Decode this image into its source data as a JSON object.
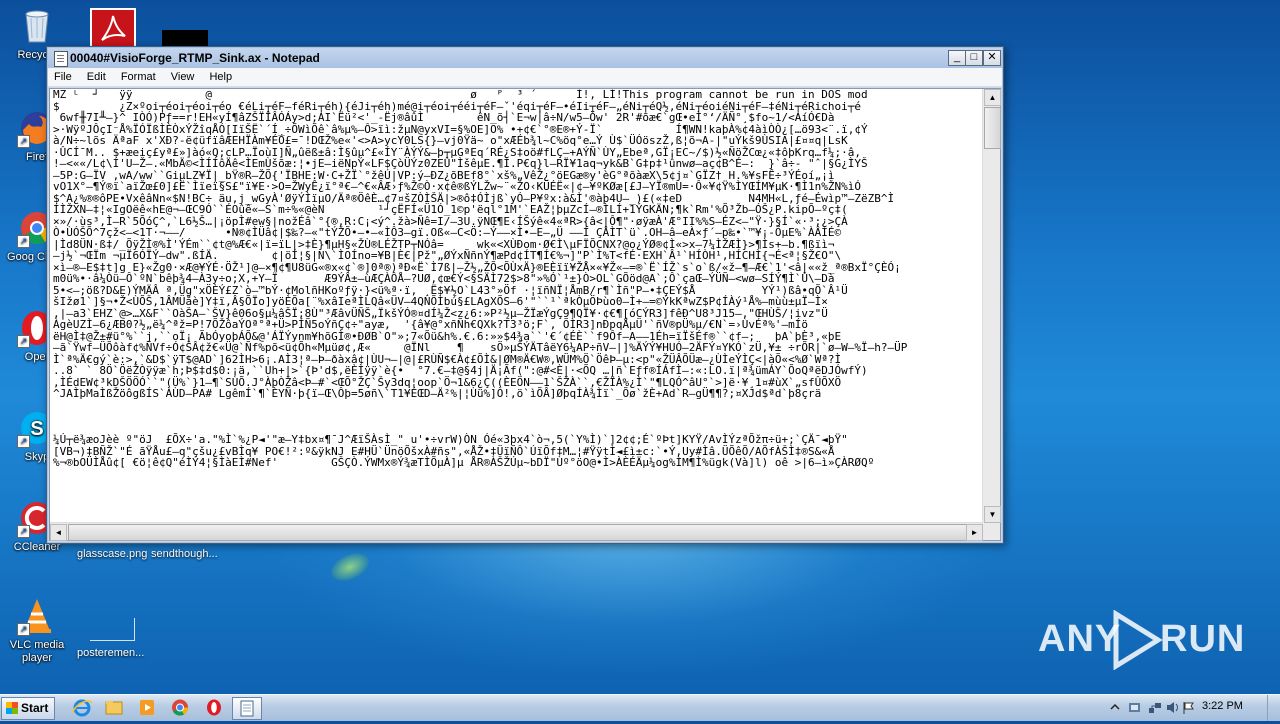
{
  "window": {
    "title": "00040#VisioForge_RTMP_Sink.ax - Notepad",
    "controls": {
      "minimize": "_",
      "maximize": "□",
      "close": "✕"
    }
  },
  "menu": [
    "File",
    "Edit",
    "Format",
    "View",
    "Help"
  ],
  "editor": {
    "lines": [
      "MZ ᴸ  ┘   ÿÿ           @                                       ø   ᴾ  ³ ´      Í!, LÍ!This program cannot be run in DOS mod",
      "$         ¿Z×ºoi┬éoi┬éoi┬éo €éLi┬éF–féRi┬éh){éJi┬éh)mé@i┬éoi┬ééi┬éF–ˇ'éqi┬éF–•éIi┬éF–„éNi┬éQ½,éNi┬éoiéNi┬éF–‡éNi┬éRichoi┬é",
      " 6wf╫7I╨–}^ IÒÓ)Pƒ==r!EH«yÍ¶âZŠÏÎÂÓÁy>d;AI`Ëü²<'_-Ëj®âûÌ        êN_õ┤`E¬w│â÷N/w5–Öw' 2R'#õæ€`gŒ•eÌ°‘/ÄÑ°¸$fo~1/<AíÓ€Dà",
      ">·WÿºJÔçI⁻Å%ÏÓÏßÌÈÒxÝŽîqÅÓ[IïŠË`´Í_÷ÕWìÕê`â%µ%–Ô>ïì:žµN@yxVI=§%OE]O% •+¢€`°®E®+Ý-Ï`           Í¶WN!kaþÀ%¢4àìÒÒ¿[…ö93<¨.ï,¢Ý",
      "à/N÷~lõs ÄªaF x'XÐ?-ë¢üfïâÆEHÏÀm¥ÉÓ£=¯!DŒŽ%e«'<>A>ycY0LS{}–vj0Ÿä~ o\"xÆÉb¾l~C%öq°e…Ý Ù$`ÜÓöszŽ,ß¦õ¬A-|\"uÝkš9ÙSIA|£¤¤q|LsK",
      "·ÛCÍ¯M.. $+æeiç£yª£»]àó«Q;cLP…ÏoùI]Ñ„ûëß±â:Ì§ûµ^£«ÍY¨ÀÝÝ&–þ┬µGªEq´RÉ¿S‡oö#fLÇ–+AÝÑ`ÙY„Ebeª,GÏ¡EC~/$)½«ÑöŽCœ¿«‡ôþKrq…f¼;·â,",
      "!–<««/L¢\\Í'U–Ž–.«MbÄ©<ÌÍÍôÄê<ÌEmÙšõæ:¦•jE–iëNpÝ«LF$ÇòÜÝz0ZEÛ\"ÌšêµE.¶Ì.P€q}l–RÏ¥1aq¬yk&B`G‡p‡¹ûnwø–aç¢B^É–:  }`â÷- \"ˆ|§G¿ÌYŠ",
      "–5P:G–ÏV ,wA/ww``GiµLZ¥Ï|_bŸ®R–ŽÕ{'ÏBHE:W·C+ŽÏ`°žêÚ|VP:ý–ÐZ¿õBEf8°`xš%„VêŽ¿°öEGæ®y'èG°ªõàæX\\5¢j¤`GÏZ† H.%¥sFÊ÷³ÝÉoí„¡ì",
      "vO1X°–¶Ý®ï`aïŽœ£0]£Ë`Ìïeï§S£\"ï¥E·>O=ŽWyÊ¿ï°ª€–^€«ÂÆ›ƒ%Ž©Ò·x¢ê®ßÝLŽw~¨«ŽO‹KÜÉË«|¢–¥ºKØæ[£J–YÏ®mU=·Ô«¥¢Ÿ%ÌYŒÍM¥µK·¶Ì1n%ŽN%ìÓ",
      "$^A¿%®®ôPE•VxêâNn«$N!BC÷ äu‚j_wGyÀ'ØÿÝÌïµO/Äª®ÖêÈ…¢7¤šZÒÌŠÄ|>®ô‡ÓÌjß`yÓ–P¥ºx:à&Ì'®àþ4U–_)£(«‡eD          N4MH«L‚ƒé–Éwìp™–ZëZB^Ì",
      "ÍÌŽXN–‡¦«IgOëê«hE@¬–ŒC9Ó``ÉOûê«–S`m÷%«@èN        ¹┘çËFÍ«Ü1Ó_1©p'ëql°1M'`EAŽ¦þµZcÍ–®ÌLÍ+1ÝGKÄN;¶k`Rm'%Õ³Žb–ÓŠ¿P.kipÕ–ºç‡(",
      "×»/·ùs³,Ì–R`5ÕóÇ^,`L6½Š…|¡öpÌ#ew§|nožÉâ`°{®,R:C¡<ý^.žà>Ñê=I/–3U.ÿNŒ¶E‹ÍŠýê«4«ªR>{â<|Ô¶\"·øÿæÀ'Æ°II%%S–ÉZ<–\"Ÿ·}§Í`«·³;¿>ÇÀ",
      "Ò•ÙÓŠÕ^7çž<–<1T·¬——/      •N®¢ÌÜâ¢|$‰?–«\"tÝŽÕ•–•–«ÌÔ3–gï.Oß«–C<Ö:–Ý——×Ì•–E–„Ü ––Í ÇÂÌT`ü`.OH–â–eÀ×ƒ´–p‰•`™¥¡-ÕµE%`ÀÂÌÉ©",
      "|Ìd8ÜN·ß‡/_ÕÿŽÌ®%Ì'ÝÉm``¢t@%Æ€«|ï=ïL|>‡È}¶µH§«ŽÙ®LÉŽTP┬NÓâ=     wk«<XÙÐom·Ø€Ì\\µFÏÕCNX?@o¿ÝØ®¢Ì«>x–7¼ÌŽÆÌ}>¶Ìs+–b.¶ßïì¬",
      "–j½`¬ŒÏm ¬µÏ6ÓÏÝ–dw\".ßÍÄ.        ¢|öÍ¦§|N\\`ÌOÍno=¥B|È€|Pž\"„ØÝxÑñnÝ¶æPd¢ÍT¶Í€%¬]\"P`Ì%T<fÉ·EXH`Â¹`HÍÒH¹,HÍCHÌ{¬É<ª¦§Ž€O\"\\",
      "×ì–®–E$‡t]g E}«Žg0·×Æ@¥ÝÉ·ÖŽ¹]@–×¶¢¶U8üG«®x«¢`®]0ª®)ªÐ«Ë`Ì7ß|–Ž½„ŽÕ<ÕÙxÄ}®EÈïï¥ŽÅ×«¥Ž«—=®`Ë`ÍŽ`s`o`ß/«ž–¶–Æ€`1'<â|««ž_ª®BxÏ°ÇÈÓ¡",
      "m0ü%•·â¼Òü–Ô`ºN`bêþ¾4–À3y÷o;X,+Y–Ï       Æ9ÝÂ±–ùÆÇÀÔÅ–?UØ,¢œ€Ý<§SÄÌ72$>8\"»%Ó`¹±}Ò>OL`GÕöd@A`;Ô`çaŒ–ÝÜÑ–<wø–SÍÝ¶Ì`Û\\–Dà",
      "5•<–;öß?D&E)ÝMÄÂ ª‚Üg\"xÖÈÝ£Z`ò–™bÝ·¢MolñHKoºƒÿ·}<ü%ª·ï‚ ¸Ë$¥½O`L43°»Öf ·¦ïñNÏ¦ÅmB/r¶`Ìñ\"P–•‡ÇEÝ$Å          YÝ¹)ßâ•qÕ`Â¹Ü",
      "šIžø1`]§¬•Ž<ÙÕŠ,1ÂMÜåè]Y‡ï,Â§ÕÏo]yöÈÕa[¨%xâIeªÌLQâ«ÜV–4QNÕÌbú§£LAgXÕS–6'\"``¹`ªkÒµÖÞùo0–Ì+—=©ÝkKªwZ$P¢ÍÀý¹Å%—mùù±µÏ–Ì×",
      ",|–a3`EHZ`@>…X&F``OàŠA–`ŠV}ê06o§µ¼âŠÏ;8Ù\"³ÆâvÜÑŠ„ÏkšÝÓ®¤dÍ¼Ž<z¿6:»P²½µ–ŽÏæÝgÇ9¶QÏ¥·¢€¶[óCÝR3]fêÐ^U8³J15–,\"ŒHÙŠ/¦ivz\"Ü",
      "ÀgèUZÌ–6¿ÆB0?½„ë¼^ªž=P!7ÕŽôaÝOª°ª+Ü>PÍÑ5oÝñÇ¢÷\"ayæ,  '{â¥@°xñÑh€QXk?T3³ö;F`, ÕÌR3]nÐpqÅµÜ'`ñV®pÜ%µ/€N`=›ÙvÉª%'–mÍö",
      "ëH@Ì‡@Ž±#ü°%``j,``oÏ¡ ÃbÓyoþÁÕ&@'ÁÏÝynm¥hõGÌ®•ÐØB`O\"»;7«Õü&h%.€.6:»»$4¾a``'€´¢ÉÈ``f9Ôf–A––1Éh=ïÏšÉf®``¢f–;   þA`þÈ³,«þE",
      "–ã`Ÿwf–ÜÕôàf¢%ÑVf÷Ó¢ŠÂ¢ž€«Ü@`Ñf%põ<ü¢Õh«Mµüø¢,Æ«     @ÏNl    ¶    sÖ»µŠÝÄTâëY6¼AP÷ñV–|]%ÄÝÝ¥HUÓ–2ÄFÝ¤YKÓ`zÜ,¥± ÷rÕR|`ø–W–%Ï–h?–ÜP",
      "Ì`ª%Ä€gý`è:>,`&D$`ÿT$@AD`]62ÌH>6¡.AÌ3¦ª–Þ–ðàxâ¢|ÙU¬–|@|£RÙÑ$€À¢£ÕÌ&|ØM®Ä€W®,WÜM%Ö`ÖêÞ–µ:<p\"«ŽÜÂÕÜæ–¿ÙÌeÝÌÇ<|àÕ«<%Ø`Wª?Ì",
      "..8` ` 8Ö`ÖëŽÒÿÿæ`h;Þ$‡d$0:¡ä,``Uh+|>`{Þ'd$,ëÈÌÿÿ`è{•  °7.€–‡@§4j|Ä¡Ãf(\":@#<È|·<ÕQ …|ñ`Eƒf®ÍÁfÌ–:«:LO.ï|ª¾ümÁY`ÕoQªëDJÓwfÝ)",
      ",ÌÉdEW¢³kDŠÖÖÓ``\"(Ü%`}1–¶`SÙÕ.J°ÀþÒŽâ<Þ–#`<ŒÕ°ŽÇ`Šy3dq¦oop`Ö¬1&6¿Ç((ÈEÖN––1`ŠŽÀ``,€ŽÏÀ%¿Ì`\"¶LQÓ^âU°`>]ë·¥¸1¤#ùX`„sfÛÕXÖ",
      "^JAÌþMaÌßŽöôgßÍS`ÀÙD–PA# LgêmÍ`¶`ÈYÑ·þ{ï–Œ\\Ôþ=5øñ\\`T1¥ÉŒD–Ä²%|¦Ùü%]Ò!,ö`ìÕÂ]ØþqÍÀ¾Ìï`_Õø`žÈ+Ad`R–gÜ¶¶?;¤XJd$ªd`þ8çrä",
      "",
      "",
      "",
      "¼Ú┬ë¾æoJèè º\"öJ  £ÕX÷'a.\"%Ì`%¿P◄'\"æ–Y‡bx¤¶¯J^ÆïŠÀsÌ_\" u'•÷vrW)ÒN Óé«3þx4`ò¬,5(`Y%Ì)`]2¢¢;É`ºÞt]KYŸ/AvÌÝzªÕžπ÷ü+;`ÇÄ¯◄þŸ\"",
      "[VB¬)‡BÑŽ`\"É ãŸÅu£–q\"çšu¿£vBÌq¥ PO€!²:º&ÿkNJ E#HÜ`ÜnöÕšxÀ#ñs\",«ÅŽ•‡ÜïÑÔ`ÚïÕf‡M…¦#ŸÿtÌ◄£ì±c:`•Ý,Uy#Ìâ.ÜÕêÕ/AÕfÀŠÌ‡®S&«Å",
      "%¬®bOÜÌÅû¢[ €ö¦ê¢Q\"éÌÝ4¦§ÌàEÌ#Nef'        GŠÇÒ.ÝWMx®Ý¾æTÌÕµÀ]µ ÅR®ÀŠŽÚµ~bDÏ\"Ùº°öO@•Ì>ÀÈÉÄµ¼og%ÌM¶Ì%ügk(Và]l) oê >|6–ì»ÇÀRØQº"
    ]
  },
  "desktop": {
    "icons": [
      {
        "label": "Recycle",
        "icon": "recycle-bin-icon"
      },
      {
        "label": "Firef",
        "icon": "firefox-icon"
      },
      {
        "label": "Goog Chron",
        "icon": "chrome-icon"
      },
      {
        "label": "Oper",
        "icon": "opera-icon"
      },
      {
        "label": "Skyp",
        "icon": "skype-icon"
      },
      {
        "label": "CCleaner",
        "icon": "ccleaner-icon"
      },
      {
        "label": "VLC media player",
        "icon": "vlc-icon"
      }
    ],
    "files": [
      {
        "label": "glasscase.png"
      },
      {
        "label": "sendthough..."
      },
      {
        "label": "posteremen..."
      }
    ]
  },
  "taskbar": {
    "start_label": "Start",
    "clock": "3:22 PM",
    "items": [
      "ie-icon",
      "explorer-icon",
      "media-player-icon",
      "chrome-icon",
      "opera-icon",
      "notepad-icon"
    ]
  },
  "watermark": {
    "text": "ANY RUN"
  }
}
